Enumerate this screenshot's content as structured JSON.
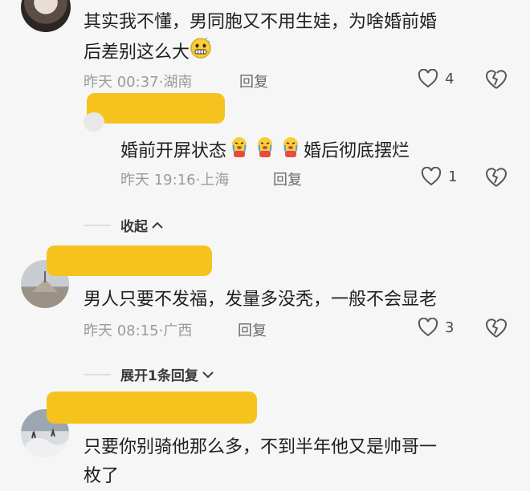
{
  "comments": [
    {
      "text_line1": "其实我不懂，男同胞又不用生娃，为啥婚前婚",
      "text_line2": "后差别这么大",
      "time": "昨天 00:37",
      "location": "湖南",
      "reply_label": "回复",
      "likes": "4"
    },
    {
      "text_before_emoji": "婚前开屏状态",
      "text_after_emoji": "婚后彻底摆烂",
      "time": "昨天 19:16",
      "location": "上海",
      "reply_label": "回复",
      "likes": "1"
    },
    {
      "text": "男人只要不发福，发量多没秃，一般不会显老",
      "time": "昨天 08:15",
      "location": "广西",
      "reply_label": "回复",
      "likes": "3"
    },
    {
      "text_line1": "只要你别骑他那么多，不到半年他又是帅哥一",
      "text_line2": "枚了"
    }
  ],
  "collapse_label": "收起",
  "expand_label": "展开1条回复",
  "meta_separator": "·",
  "colors": {
    "redaction": "#f6c21d",
    "background": "#f6f6f6"
  },
  "icons": {
    "like": "heart-outline-icon",
    "dislike": "broken-heart-icon",
    "collapse": "chevron-up-icon",
    "expand": "chevron-down-icon"
  }
}
